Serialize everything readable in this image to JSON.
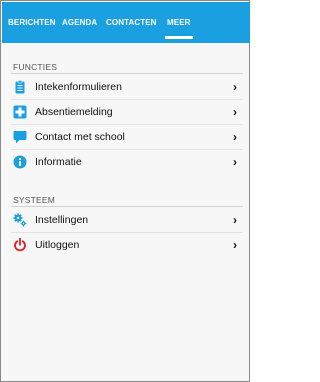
{
  "tabs": [
    {
      "label": "BERICHTEN",
      "active": false
    },
    {
      "label": "AGENDA",
      "active": false
    },
    {
      "label": "CONTACTEN",
      "active": false
    },
    {
      "label": "MEER",
      "active": true
    }
  ],
  "colors": {
    "tab_bar": "#1a9fe0",
    "icon_blue": "#1a9fe0",
    "logout_red": "#e02020"
  },
  "sections": [
    {
      "title": "FUNCTIES",
      "items": [
        {
          "label": "Intekenformulieren",
          "icon": "clipboard-icon",
          "chevron": "›"
        },
        {
          "label": "Absentiemelding",
          "icon": "medical-cross-icon",
          "chevron": "›"
        },
        {
          "label": "Contact met school",
          "icon": "speech-bubble-icon",
          "chevron": "›"
        },
        {
          "label": "Informatie",
          "icon": "info-icon",
          "chevron": "›"
        }
      ]
    },
    {
      "title": "SYSTEEM",
      "items": [
        {
          "label": "Instellingen",
          "icon": "gears-icon",
          "chevron": "›"
        },
        {
          "label": "Uitloggen",
          "icon": "power-icon",
          "chevron": "›"
        }
      ]
    }
  ]
}
